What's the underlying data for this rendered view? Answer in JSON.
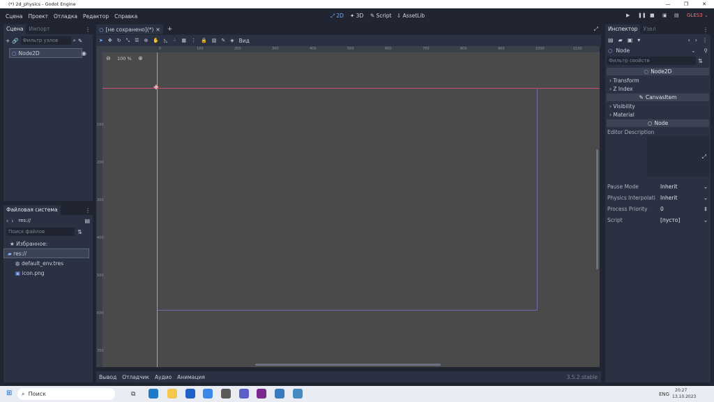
{
  "window": {
    "title": "(*) 2d_physics - Godot Engine",
    "buttons": [
      "—",
      "❐",
      "✕"
    ]
  },
  "menu": [
    "Сцена",
    "Проект",
    "Отладка",
    "Редактор",
    "Справка"
  ],
  "workspaces": {
    "w2d": "2D",
    "w3d": "3D",
    "script": "Script",
    "assetlib": "AssetLib"
  },
  "renderer": "GLES3",
  "scene_panel": {
    "tabs": [
      "Сцена",
      "Импорт"
    ],
    "filter_placeholder": "Фильтр узлов",
    "root_node": "Node2D"
  },
  "fs_panel": {
    "title": "Файловая система",
    "path": "res://",
    "search_placeholder": "Поиск файлов",
    "items": [
      "Избранное:",
      "res://",
      "default_env.tres",
      "icon.png"
    ]
  },
  "editor": {
    "tab": "[не сохранено](*)",
    "zoom": "100 %",
    "view_label": "Вид",
    "ruler_x": [
      "0",
      "100",
      "200",
      "300",
      "400",
      "500",
      "600",
      "700",
      "800",
      "900",
      "1000",
      "1100"
    ],
    "ruler_y": [
      "100",
      "200",
      "300",
      "400",
      "500",
      "600",
      "700",
      "800"
    ]
  },
  "bottom": {
    "tabs": [
      "Вывод",
      "Отладчик",
      "Аудио",
      "Анимация"
    ],
    "version": "3.5.2.stable"
  },
  "inspector": {
    "tabs": [
      "Инспектор",
      "Узел"
    ],
    "node": "Node",
    "filter_placeholder": "Фильтр свойств",
    "header_node2d": "Node2D",
    "transform": "Transform",
    "zindex": "Z Index",
    "canvas": "CanvasItem",
    "visibility": "Visibility",
    "material": "Material",
    "desc": "Editor Description",
    "props": [
      {
        "label": "Pause Mode",
        "value": "Inherit"
      },
      {
        "label": "Physics Interpolati",
        "value": "Inherit"
      },
      {
        "label": "Process Priority",
        "value": "0"
      },
      {
        "label": "Script",
        "value": "[пусто]"
      }
    ]
  },
  "taskbar": {
    "search": "Поиск",
    "lang": "ENG",
    "time": "20:27",
    "date": "13.10.2023"
  },
  "colors": {
    "bg": "#202531",
    "panel": "#2a3142",
    "viewport": "#4a4a4a",
    "accent": "#6fb1ff",
    "gles": "#ff6b6b"
  }
}
